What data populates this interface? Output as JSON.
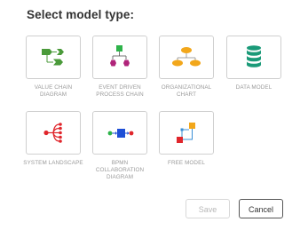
{
  "dialog": {
    "title": "Select model type:"
  },
  "models": [
    {
      "label": "VALUE CHAIN DIAGRAM",
      "icon": "value-chain-icon",
      "color": "#4a9a3a"
    },
    {
      "label": "EVENT DRIVEN PROCESS CHAIN",
      "icon": "event-driven-process-chain-icon",
      "colors": [
        "#2eb34a",
        "#b0247a"
      ]
    },
    {
      "label": "ORGANIZATIONAL CHART",
      "icon": "org-chart-icon",
      "color": "#f2a71b"
    },
    {
      "label": "DATA MODEL",
      "icon": "database-icon",
      "color": "#1a9a78"
    },
    {
      "label": "SYSTEM LANDSCAPE",
      "icon": "system-landscape-icon",
      "color": "#e0262c"
    },
    {
      "label": "BPMN COLLABORATION DIAGRAM",
      "icon": "bpmn-collaboration-icon",
      "colors": [
        "#1e4fd6",
        "#e0262c",
        "#2eb34a"
      ]
    },
    {
      "label": "FREE MODEL",
      "icon": "free-model-icon",
      "colors": [
        "#f2a71b",
        "#e0262c",
        "#3a8fd6"
      ]
    }
  ],
  "buttons": {
    "save": "Save",
    "cancel": "Cancel"
  }
}
